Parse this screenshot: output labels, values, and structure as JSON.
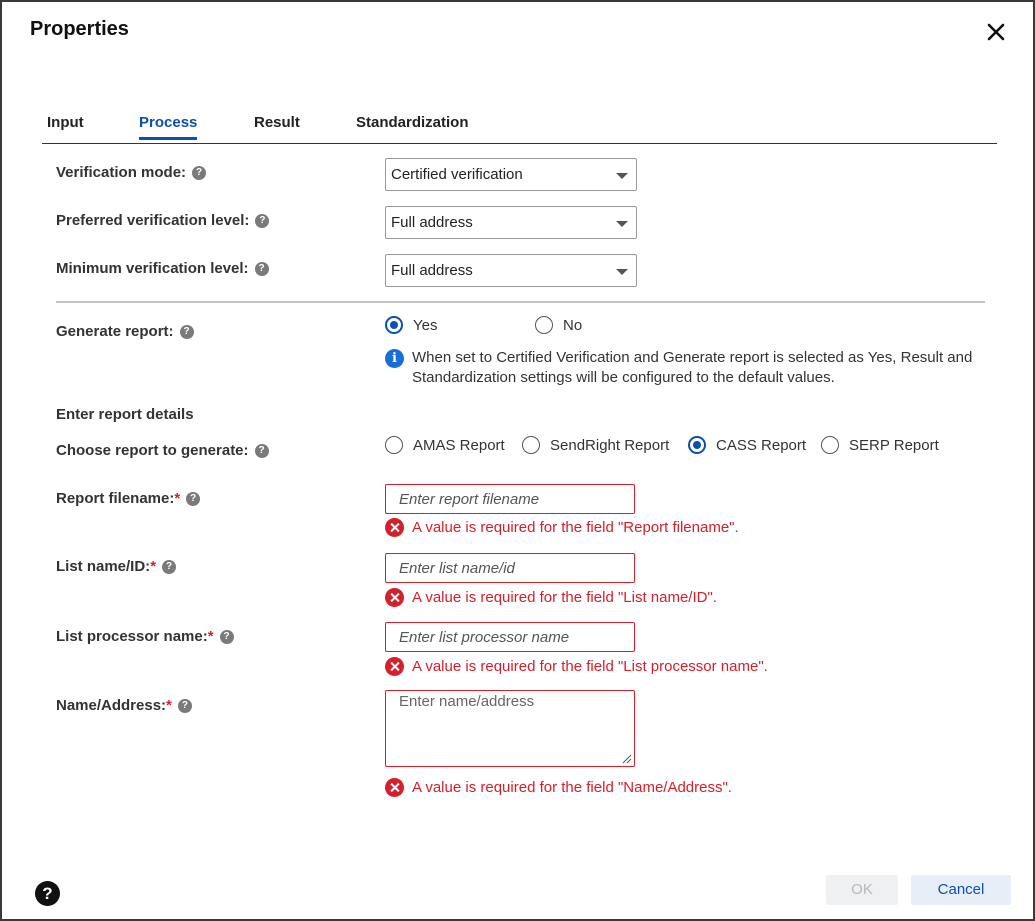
{
  "dialog": {
    "title": "Properties"
  },
  "tabs": [
    {
      "label": "Input"
    },
    {
      "label": "Process",
      "active": true
    },
    {
      "label": "Result"
    },
    {
      "label": "Standardization"
    }
  ],
  "fields": {
    "verification_mode": {
      "label": "Verification mode:",
      "value": "Certified verification"
    },
    "preferred_level": {
      "label": "Preferred verification level:",
      "value": "Full address"
    },
    "minimum_level": {
      "label": "Minimum verification level:",
      "value": "Full address"
    },
    "generate_report": {
      "label": "Generate report:",
      "options": [
        "Yes",
        "No"
      ],
      "selected": "Yes",
      "info": "When set to Certified Verification and Generate report is selected as Yes, Result and Standardization settings will be configured to the default values."
    },
    "report_details_heading": "Enter report details",
    "report_choice": {
      "label": "Choose report to generate:",
      "options": [
        "AMAS Report",
        "SendRight Report",
        "CASS Report",
        "SERP Report"
      ],
      "selected": "CASS Report"
    },
    "report_filename": {
      "label": "Report filename:",
      "required_mark": "*",
      "placeholder": "Enter report filename",
      "error": "A value is required for the field \"Report filename\"."
    },
    "list_name": {
      "label": "List name/ID:",
      "required_mark": "*",
      "placeholder": "Enter list name/id",
      "error": "A value is required for the field \"List name/ID\"."
    },
    "list_processor": {
      "label": "List processor name:",
      "required_mark": "*",
      "placeholder": "Enter list processor name",
      "error": "A value is required for the field \"List processor name\"."
    },
    "name_address": {
      "label": "Name/Address:",
      "required_mark": "*",
      "placeholder": "Enter name/address",
      "error": "A value is required for the field \"Name/Address\"."
    }
  },
  "footer": {
    "ok_label": "OK",
    "cancel_label": "Cancel",
    "help_glyph": "?"
  },
  "icons": {
    "help_glyph": "?",
    "info_glyph": "i"
  },
  "colors": {
    "accent": "#0b4fb0",
    "error": "#d4202a",
    "info": "#1a6fd6"
  }
}
